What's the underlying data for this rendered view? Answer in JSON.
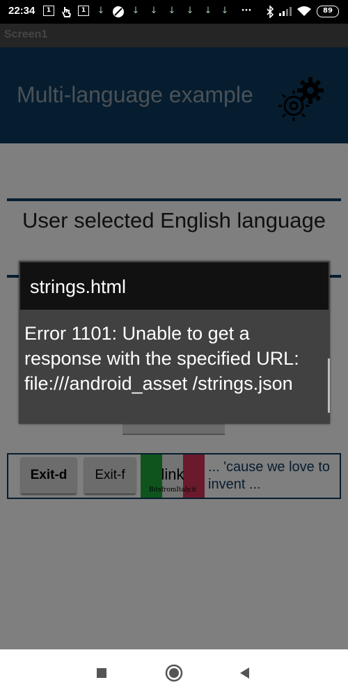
{
  "status_bar": {
    "time": "22:34",
    "badge_1": "1",
    "badge_2": "1",
    "battery": "89",
    "icons": [
      "sim-icon",
      "touch-icon",
      "sim-icon",
      "download-icon",
      "blocked-icon",
      "download-icon",
      "download-icon",
      "download-icon",
      "download-icon",
      "download-icon",
      "more-icon",
      "bluetooth-icon",
      "signal-icon",
      "wifi-icon",
      "battery-icon"
    ],
    "more": "···"
  },
  "app": {
    "screen_title": "Screen1",
    "heading": "Multi-language example",
    "selected_language_text": "User selected English language",
    "footer": {
      "exit_d_label": "Exit-d",
      "exit_f_label": "Exit-f",
      "link_text": "link",
      "site_text": "BitsfromItaly.it",
      "tagline": "... 'cause we love to invent ..."
    }
  },
  "dialog": {
    "title": "strings.html",
    "message": "Error 1101: Unable to get a response with the specified URL: file:///android_asset /strings.json"
  },
  "nav_bar": {
    "icons": [
      "recent-apps-icon",
      "home-icon",
      "back-icon"
    ]
  },
  "colors": {
    "header_bg": "#0c3a5e",
    "heading_text": "#95a3ad",
    "dialog_bg": "#414141",
    "dialog_title_bg": "#111111"
  }
}
